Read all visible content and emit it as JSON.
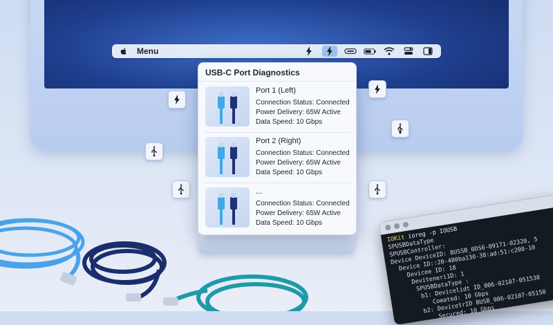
{
  "menubar": {
    "menu_label": "Menu",
    "icons": [
      "apple-icon",
      "bolt-icon",
      "thunderbolt-icon",
      "usb-c-port-icon",
      "battery-icon",
      "wifi-icon",
      "control-center-icon",
      "sidebar-icon"
    ]
  },
  "popup": {
    "title": "USB-C Port Diagnostics",
    "ports": [
      {
        "name": "Port 1 (Left)",
        "status": "Connection Status: Connected",
        "power": "Power Delivery: 65W Active",
        "speed": "Data Speed: 10 Gbps"
      },
      {
        "name": "Port 2 (Right)",
        "status": "Connection Status: Connected",
        "power": "Power Delivery: 65W Active",
        "speed": "Data Speed: 10 Gbps"
      },
      {
        "name": "...",
        "status": "Connection Status: Connected",
        "power": "Power Delivery: 65W Active",
        "speed": "Data Speed: 10 Gbps"
      }
    ]
  },
  "terminal": {
    "prompt": "IOKit",
    "command": " ioreg -p IOUSB",
    "lines": [
      "SPUSBDataType",
      "SPUSBController:",
      "Device DeviceID: 8USSB_0DS6-09171-02320, 5",
      "  Device ID::20-480ba130-38:ad:51:c200-10",
      "    Devicee ID: 18",
      "     Deviteneri1D: 1",
      "      SPUSBDataType :",
      "       b1: Devicelidt ID_006-02107-051538",
      "          Comated: 10 Gbps",
      "       b2: DevicetrID 8USB_006-02107-05150",
      "           Secured: 10 Gbps"
    ]
  },
  "colors": {
    "accent": "#9ec1f2",
    "screen": "#1f3f8f",
    "cable_light": "#4aa3e8",
    "cable_dark": "#1b2d6b",
    "cable_teal": "#1f9aa8"
  }
}
